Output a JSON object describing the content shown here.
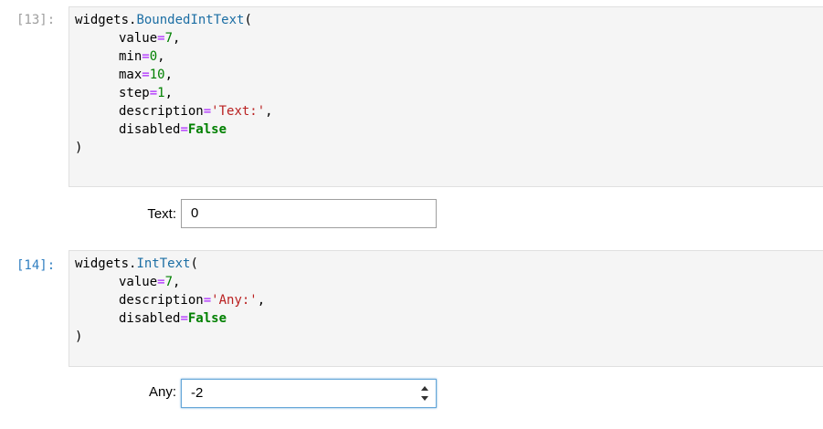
{
  "cells": [
    {
      "prompt": "[13]:",
      "code": {
        "l1": {
          "obj": "widgets.",
          "fn": "BoundedIntText",
          "open": "("
        },
        "l2": {
          "name": "value",
          "eq": "=",
          "val": "7",
          "tail": ","
        },
        "l3": {
          "name": "min",
          "eq": "=",
          "val": "0",
          "tail": ","
        },
        "l4": {
          "name": "max",
          "eq": "=",
          "val": "10",
          "tail": ","
        },
        "l5": {
          "name": "step",
          "eq": "=",
          "val": "1",
          "tail": ","
        },
        "l6": {
          "name": "description",
          "eq": "=",
          "val": "'Text:'",
          "tail": ","
        },
        "l7": {
          "name": "disabled",
          "eq": "=",
          "val": "False"
        },
        "l8": {
          "close": ")"
        }
      },
      "output": {
        "label": "Text:",
        "value": "0"
      }
    },
    {
      "prompt": "[14]:",
      "code": {
        "l1": {
          "obj": "widgets.",
          "fn": "IntText",
          "open": "("
        },
        "l2": {
          "name": "value",
          "eq": "=",
          "val": "7",
          "tail": ","
        },
        "l3": {
          "name": "description",
          "eq": "=",
          "val": "'Any:'",
          "tail": ","
        },
        "l4": {
          "name": "disabled",
          "eq": "=",
          "val": "False"
        },
        "l5": {
          "close": ")"
        }
      },
      "output": {
        "label": "Any:",
        "value": "-2"
      }
    }
  ],
  "colors": {
    "prompt_inactive": "#9e9e9e",
    "prompt_active": "#307fc1",
    "function": "#1c6ea4",
    "operator": "#aa22ff",
    "number": "#008000",
    "string": "#ba2121",
    "focus_border": "#64a6d8"
  }
}
